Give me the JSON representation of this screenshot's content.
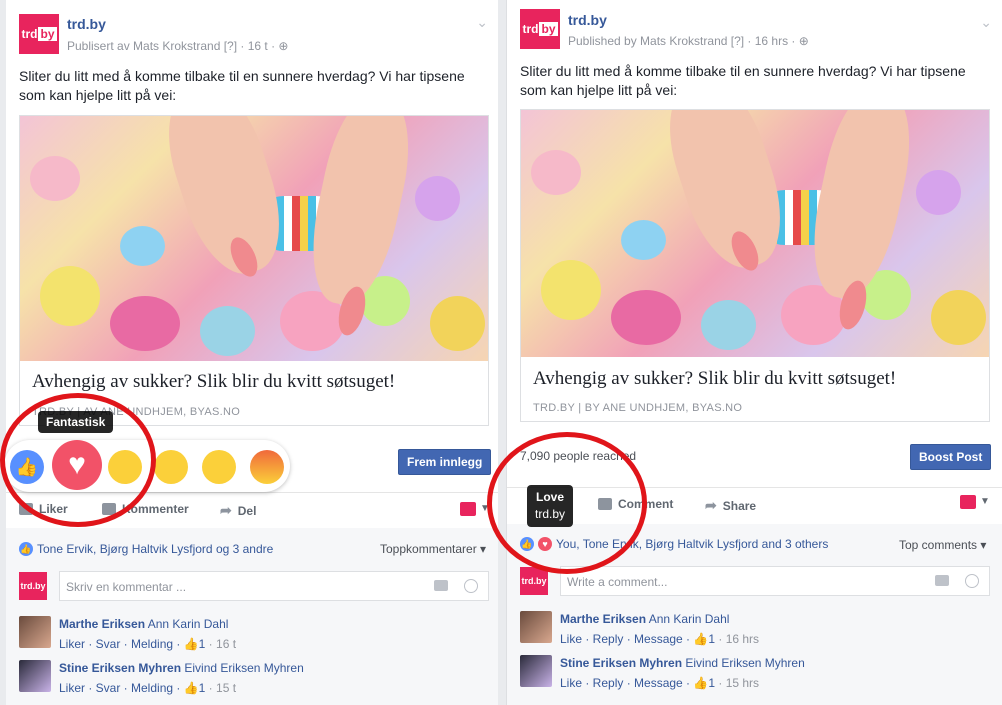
{
  "left": {
    "page_name": "trd.by",
    "avatar_text": "trd",
    "avatar_text2": "by",
    "published_by": "Publisert av Mats Krokstrand [?] · 16 t · ",
    "body_text": "Sliter du litt med å komme tilbake til en sunnere hverdag? Vi har tipsene som kan hjelpe litt på vei:",
    "link_title": "Avhengig av sukker? Slik blir du kvitt søtsuget!",
    "link_source": "TRD.BY | AV ANE UNDHJEM, BYAS.NO",
    "boost_button": "Frem innlegg",
    "tooltip": "Fantastisk",
    "action_like": "Liker",
    "action_comment": "Kommenter",
    "action_share": "Del",
    "likers": "Tone Ervik, Bjørg Haltvik Lysfjord og 3 andre",
    "top_comments": "Toppkommentarer ▾",
    "comment_placeholder": "Skriv en kommentar ...",
    "comments": [
      {
        "name": "Marthe Eriksen",
        "tag": "Ann Karin Dahl",
        "meta": "Liker · Svar · Melding · ",
        "likes": "1",
        "time": "16 t"
      },
      {
        "name": "Stine Eriksen Myhren",
        "tag": "Eivind Eriksen Myhren",
        "meta": "Liker · Svar · Melding · ",
        "likes": "1",
        "time": "15 t"
      }
    ]
  },
  "right": {
    "page_name": "trd.by",
    "avatar_text": "trd",
    "avatar_text2": "by",
    "published_by": "Published by Mats Krokstrand [?] · 16 hrs · ",
    "body_text": "Sliter du litt med å komme tilbake til en sunnere hverdag? Vi har tipsene som kan hjelpe litt på vei:",
    "link_title": "Avhengig av sukker? Slik blir du kvitt søtsuget!",
    "link_source": "TRD.BY | BY ANE UNDHJEM, BYAS.NO",
    "reached": "7,090 people reached",
    "boost_button": "Boost Post",
    "tooltip_title": "Love",
    "tooltip_sub": "trd.by",
    "action_comment": "Comment",
    "action_share": "Share",
    "likers": "You, Tone Ervik, Bjørg Haltvik Lysfjord and 3 others",
    "top_comments": "Top comments ▾",
    "comment_placeholder": "Write a comment...",
    "comments": [
      {
        "name": "Marthe Eriksen",
        "tag": "Ann Karin Dahl",
        "meta": "Like · Reply · Message · ",
        "likes": "1",
        "time": "16 hrs"
      },
      {
        "name": "Stine Eriksen Myhren",
        "tag": "Eivind Eriksen Myhren",
        "meta": "Like · Reply · Message · ",
        "likes": "1",
        "time": "15 hrs"
      }
    ]
  },
  "icons": {
    "globe": "globe-icon",
    "chevron": "chevron-down-icon",
    "like": "like-icon",
    "comment": "comment-icon",
    "share": "share-icon",
    "camera": "camera-icon",
    "emoji": "emoji-icon"
  },
  "colors": {
    "brand": "#e8245d",
    "fb_blue": "#4267b2",
    "link_blue": "#365899",
    "highlight_circle": "#e0151a"
  }
}
